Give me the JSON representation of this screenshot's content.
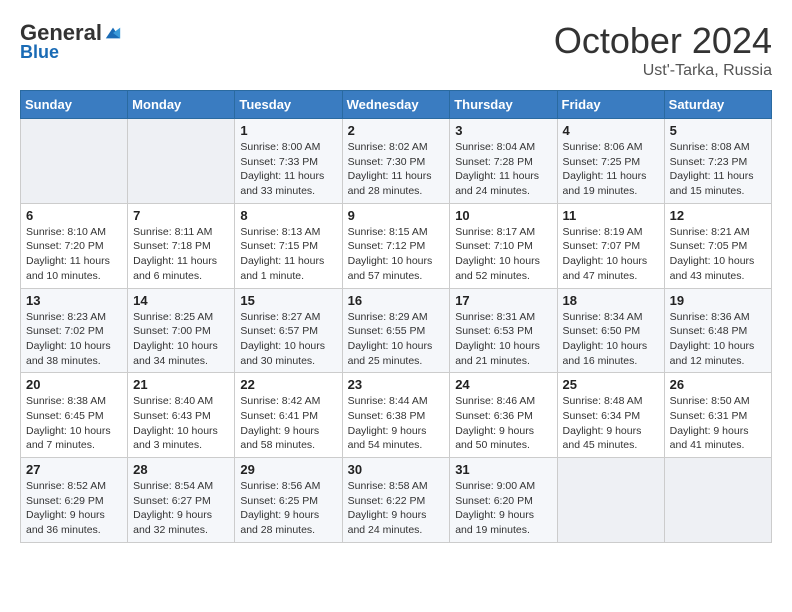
{
  "logo": {
    "general": "General",
    "blue": "Blue"
  },
  "header": {
    "month": "October 2024",
    "location": "Ust'-Tarka, Russia"
  },
  "weekdays": [
    "Sunday",
    "Monday",
    "Tuesday",
    "Wednesday",
    "Thursday",
    "Friday",
    "Saturday"
  ],
  "weeks": [
    [
      {
        "day": "",
        "sunrise": "",
        "sunset": "",
        "daylight": ""
      },
      {
        "day": "",
        "sunrise": "",
        "sunset": "",
        "daylight": ""
      },
      {
        "day": "1",
        "sunrise": "Sunrise: 8:00 AM",
        "sunset": "Sunset: 7:33 PM",
        "daylight": "Daylight: 11 hours and 33 minutes."
      },
      {
        "day": "2",
        "sunrise": "Sunrise: 8:02 AM",
        "sunset": "Sunset: 7:30 PM",
        "daylight": "Daylight: 11 hours and 28 minutes."
      },
      {
        "day": "3",
        "sunrise": "Sunrise: 8:04 AM",
        "sunset": "Sunset: 7:28 PM",
        "daylight": "Daylight: 11 hours and 24 minutes."
      },
      {
        "day": "4",
        "sunrise": "Sunrise: 8:06 AM",
        "sunset": "Sunset: 7:25 PM",
        "daylight": "Daylight: 11 hours and 19 minutes."
      },
      {
        "day": "5",
        "sunrise": "Sunrise: 8:08 AM",
        "sunset": "Sunset: 7:23 PM",
        "daylight": "Daylight: 11 hours and 15 minutes."
      }
    ],
    [
      {
        "day": "6",
        "sunrise": "Sunrise: 8:10 AM",
        "sunset": "Sunset: 7:20 PM",
        "daylight": "Daylight: 11 hours and 10 minutes."
      },
      {
        "day": "7",
        "sunrise": "Sunrise: 8:11 AM",
        "sunset": "Sunset: 7:18 PM",
        "daylight": "Daylight: 11 hours and 6 minutes."
      },
      {
        "day": "8",
        "sunrise": "Sunrise: 8:13 AM",
        "sunset": "Sunset: 7:15 PM",
        "daylight": "Daylight: 11 hours and 1 minute."
      },
      {
        "day": "9",
        "sunrise": "Sunrise: 8:15 AM",
        "sunset": "Sunset: 7:12 PM",
        "daylight": "Daylight: 10 hours and 57 minutes."
      },
      {
        "day": "10",
        "sunrise": "Sunrise: 8:17 AM",
        "sunset": "Sunset: 7:10 PM",
        "daylight": "Daylight: 10 hours and 52 minutes."
      },
      {
        "day": "11",
        "sunrise": "Sunrise: 8:19 AM",
        "sunset": "Sunset: 7:07 PM",
        "daylight": "Daylight: 10 hours and 47 minutes."
      },
      {
        "day": "12",
        "sunrise": "Sunrise: 8:21 AM",
        "sunset": "Sunset: 7:05 PM",
        "daylight": "Daylight: 10 hours and 43 minutes."
      }
    ],
    [
      {
        "day": "13",
        "sunrise": "Sunrise: 8:23 AM",
        "sunset": "Sunset: 7:02 PM",
        "daylight": "Daylight: 10 hours and 38 minutes."
      },
      {
        "day": "14",
        "sunrise": "Sunrise: 8:25 AM",
        "sunset": "Sunset: 7:00 PM",
        "daylight": "Daylight: 10 hours and 34 minutes."
      },
      {
        "day": "15",
        "sunrise": "Sunrise: 8:27 AM",
        "sunset": "Sunset: 6:57 PM",
        "daylight": "Daylight: 10 hours and 30 minutes."
      },
      {
        "day": "16",
        "sunrise": "Sunrise: 8:29 AM",
        "sunset": "Sunset: 6:55 PM",
        "daylight": "Daylight: 10 hours and 25 minutes."
      },
      {
        "day": "17",
        "sunrise": "Sunrise: 8:31 AM",
        "sunset": "Sunset: 6:53 PM",
        "daylight": "Daylight: 10 hours and 21 minutes."
      },
      {
        "day": "18",
        "sunrise": "Sunrise: 8:34 AM",
        "sunset": "Sunset: 6:50 PM",
        "daylight": "Daylight: 10 hours and 16 minutes."
      },
      {
        "day": "19",
        "sunrise": "Sunrise: 8:36 AM",
        "sunset": "Sunset: 6:48 PM",
        "daylight": "Daylight: 10 hours and 12 minutes."
      }
    ],
    [
      {
        "day": "20",
        "sunrise": "Sunrise: 8:38 AM",
        "sunset": "Sunset: 6:45 PM",
        "daylight": "Daylight: 10 hours and 7 minutes."
      },
      {
        "day": "21",
        "sunrise": "Sunrise: 8:40 AM",
        "sunset": "Sunset: 6:43 PM",
        "daylight": "Daylight: 10 hours and 3 minutes."
      },
      {
        "day": "22",
        "sunrise": "Sunrise: 8:42 AM",
        "sunset": "Sunset: 6:41 PM",
        "daylight": "Daylight: 9 hours and 58 minutes."
      },
      {
        "day": "23",
        "sunrise": "Sunrise: 8:44 AM",
        "sunset": "Sunset: 6:38 PM",
        "daylight": "Daylight: 9 hours and 54 minutes."
      },
      {
        "day": "24",
        "sunrise": "Sunrise: 8:46 AM",
        "sunset": "Sunset: 6:36 PM",
        "daylight": "Daylight: 9 hours and 50 minutes."
      },
      {
        "day": "25",
        "sunrise": "Sunrise: 8:48 AM",
        "sunset": "Sunset: 6:34 PM",
        "daylight": "Daylight: 9 hours and 45 minutes."
      },
      {
        "day": "26",
        "sunrise": "Sunrise: 8:50 AM",
        "sunset": "Sunset: 6:31 PM",
        "daylight": "Daylight: 9 hours and 41 minutes."
      }
    ],
    [
      {
        "day": "27",
        "sunrise": "Sunrise: 8:52 AM",
        "sunset": "Sunset: 6:29 PM",
        "daylight": "Daylight: 9 hours and 36 minutes."
      },
      {
        "day": "28",
        "sunrise": "Sunrise: 8:54 AM",
        "sunset": "Sunset: 6:27 PM",
        "daylight": "Daylight: 9 hours and 32 minutes."
      },
      {
        "day": "29",
        "sunrise": "Sunrise: 8:56 AM",
        "sunset": "Sunset: 6:25 PM",
        "daylight": "Daylight: 9 hours and 28 minutes."
      },
      {
        "day": "30",
        "sunrise": "Sunrise: 8:58 AM",
        "sunset": "Sunset: 6:22 PM",
        "daylight": "Daylight: 9 hours and 24 minutes."
      },
      {
        "day": "31",
        "sunrise": "Sunrise: 9:00 AM",
        "sunset": "Sunset: 6:20 PM",
        "daylight": "Daylight: 9 hours and 19 minutes."
      },
      {
        "day": "",
        "sunrise": "",
        "sunset": "",
        "daylight": ""
      },
      {
        "day": "",
        "sunrise": "",
        "sunset": "",
        "daylight": ""
      }
    ]
  ]
}
